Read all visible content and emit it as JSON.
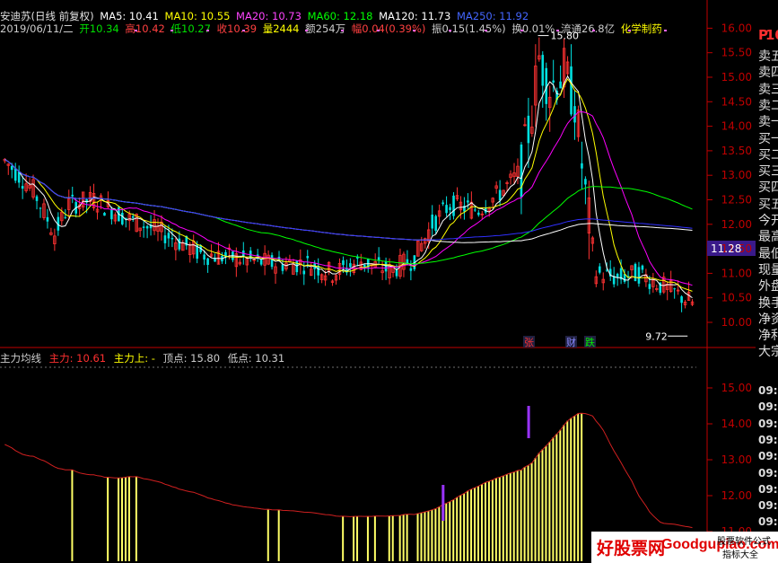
{
  "header": {
    "stock": "安迪苏(日线 前复权)",
    "ma5": "MA5: 10.41",
    "ma10": "MA10: 10.55",
    "ma20": "MA20: 10.73",
    "ma60": "MA60: 12.18",
    "ma120": "MA120: 11.73",
    "ma250": "MA250: 11.92",
    "date": "2019/06/11/二",
    "open": "开10.34",
    "high": "高10.42",
    "low": "低10.27",
    "close": "收10.39",
    "volume": "量2444",
    "amount": "额254万",
    "change": "幅0.04(0.39%)",
    "amplitude": "振0.15(1.45%)",
    "turnover": "换0.01%",
    "float_cap": "流通26.8亿",
    "industry": "化学制药"
  },
  "price_axis": {
    "labels": [
      "16.00",
      "15.50",
      "15.00",
      "14.50",
      "14.00",
      "13.50",
      "13.00",
      "12.50",
      "12.00",
      "11.50",
      "11.00",
      "10.50",
      "10.00"
    ],
    "current": "11.28"
  },
  "chart_marks": {
    "high": "15.80",
    "low": "9.72",
    "events": [
      "张",
      "财",
      "跌"
    ]
  },
  "indicator": {
    "name": "主力均线",
    "main_label": "主力: 10.61",
    "upper_label": "主力上: -",
    "top_label": "顶点: 15.80",
    "low_label": "低点: 10.31",
    "axis_labels": [
      "15.00",
      "14.00",
      "13.00",
      "12.00",
      "11.00"
    ]
  },
  "side_panel": {
    "logo": "P",
    "price": "10",
    "rows": [
      "卖五",
      "卖四",
      "卖三",
      "卖二",
      "卖一",
      "买一",
      "买二",
      "买三",
      "买四",
      "买五",
      "今开",
      "最高",
      "最低",
      "现量",
      "外盘",
      "换手",
      "净资",
      "净利",
      "大宗"
    ],
    "times": [
      "09:",
      "09:",
      "09:",
      "09:",
      "09:",
      "09:",
      "09:",
      "09:",
      "09:",
      "09:"
    ]
  },
  "watermark": {
    "brand": "好股票网",
    "domain": "Goodgupiao.com",
    "tag1": "股票软件公式",
    "tag2": "指标大全"
  },
  "colors": {
    "ma5": "#ffffff",
    "ma10": "#ffff00",
    "ma20": "#ff00ff",
    "ma60": "#00ff00",
    "ma120": "#ffffff",
    "ma250": "#3030ff",
    "up": "#ff3232",
    "down": "#00e0e0",
    "axis": "#c00000",
    "indicator_bar": "#ffff66",
    "indicator_line": "#d02020",
    "marker": "#9933ff"
  }
}
